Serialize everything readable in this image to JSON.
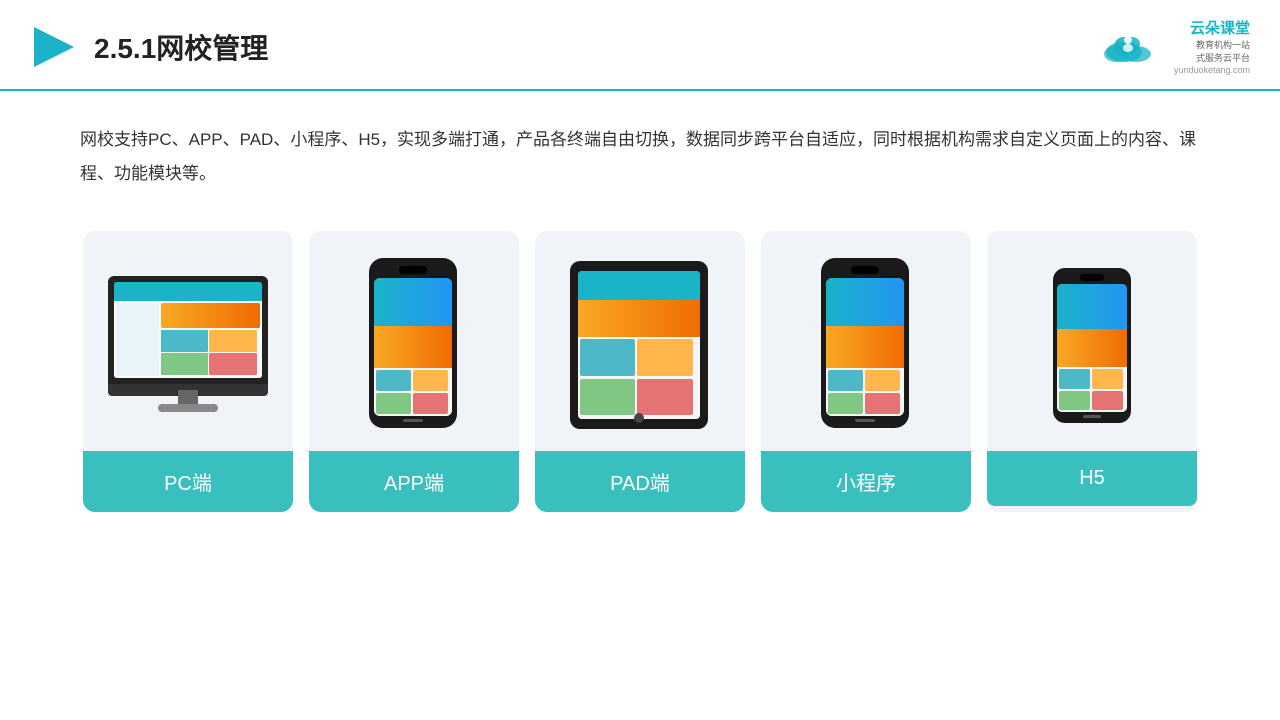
{
  "header": {
    "title": "2.5.1网校管理",
    "logo_name": "云朵课堂",
    "logo_url": "yunduoketang.com",
    "logo_tagline": "教育机构一站\n式服务云平台"
  },
  "description": {
    "text": "网校支持PC、APP、PAD、小程序、H5，实现多端打通，产品各终端自由切换，数据同步跨平台自适应，同时根据机构需求自定义页面上的内容、课程、功能模块等。"
  },
  "cards": [
    {
      "id": "pc",
      "label": "PC端"
    },
    {
      "id": "app",
      "label": "APP端"
    },
    {
      "id": "pad",
      "label": "PAD端"
    },
    {
      "id": "miniprogram",
      "label": "小程序"
    },
    {
      "id": "h5",
      "label": "H5"
    }
  ],
  "colors": {
    "accent": "#1ab3c8",
    "teal": "#3abfbf",
    "border_bottom": "#1ab3c8",
    "card_bg": "#eef2f6"
  }
}
